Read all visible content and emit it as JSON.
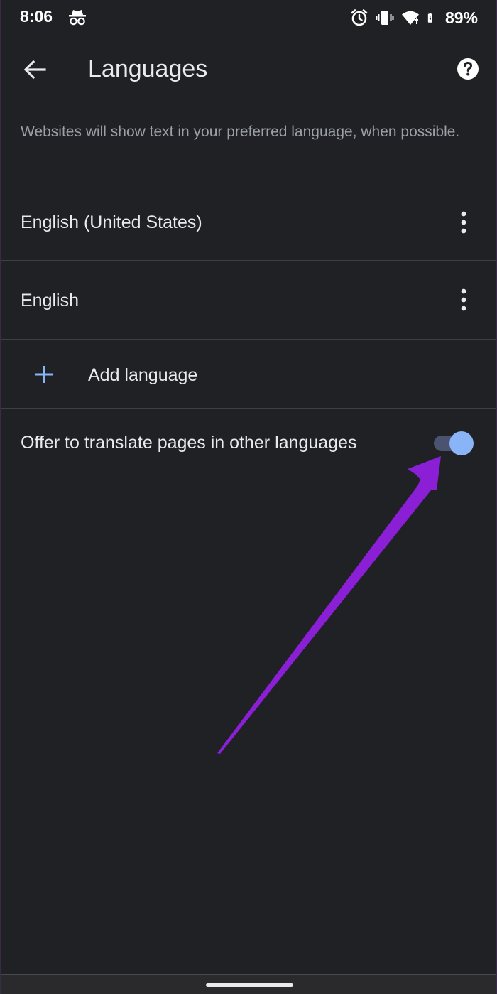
{
  "status_bar": {
    "time": "8:06",
    "battery_percent": "89%",
    "icons": [
      "incognito-icon",
      "alarm-icon",
      "vibrate-icon",
      "wifi-icon",
      "battery-charging-icon"
    ]
  },
  "app_bar": {
    "title": "Languages",
    "back_icon": "back-arrow-icon",
    "help_icon": "help-icon"
  },
  "description": "Websites will show text in your preferred language, when possible.",
  "languages": [
    {
      "label": "English (United States)",
      "menu_icon": "more-vert-icon"
    },
    {
      "label": "English",
      "menu_icon": "more-vert-icon"
    }
  ],
  "add_language": {
    "label": "Add language",
    "icon": "plus-icon"
  },
  "translate_offer": {
    "label": "Offer to translate pages in other languages",
    "enabled": true
  },
  "colors": {
    "background": "#202124",
    "text_primary": "#e8eaed",
    "text_secondary": "#9aa0a6",
    "accent": "#8ab4f8",
    "annotation_arrow": "#8a1fd6"
  }
}
